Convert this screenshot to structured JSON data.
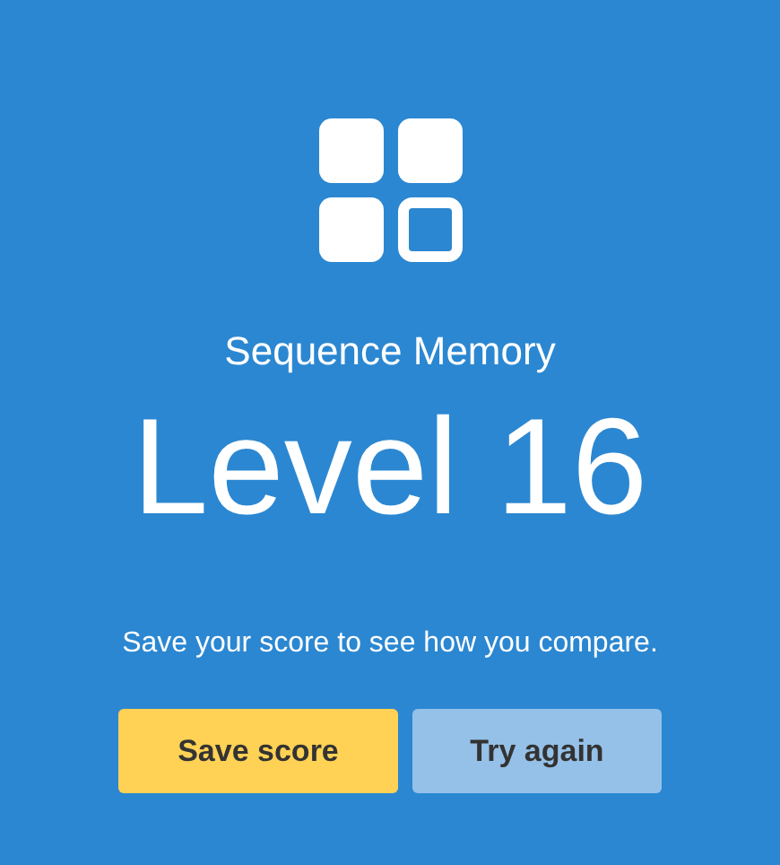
{
  "game": "Sequence Memory",
  "result": "Level 16",
  "message": "Save your score to see how you compare.",
  "buttons": [
    {
      "label": "Save score",
      "kind": "primary"
    },
    {
      "label": "Try again",
      "kind": "secondary"
    }
  ]
}
